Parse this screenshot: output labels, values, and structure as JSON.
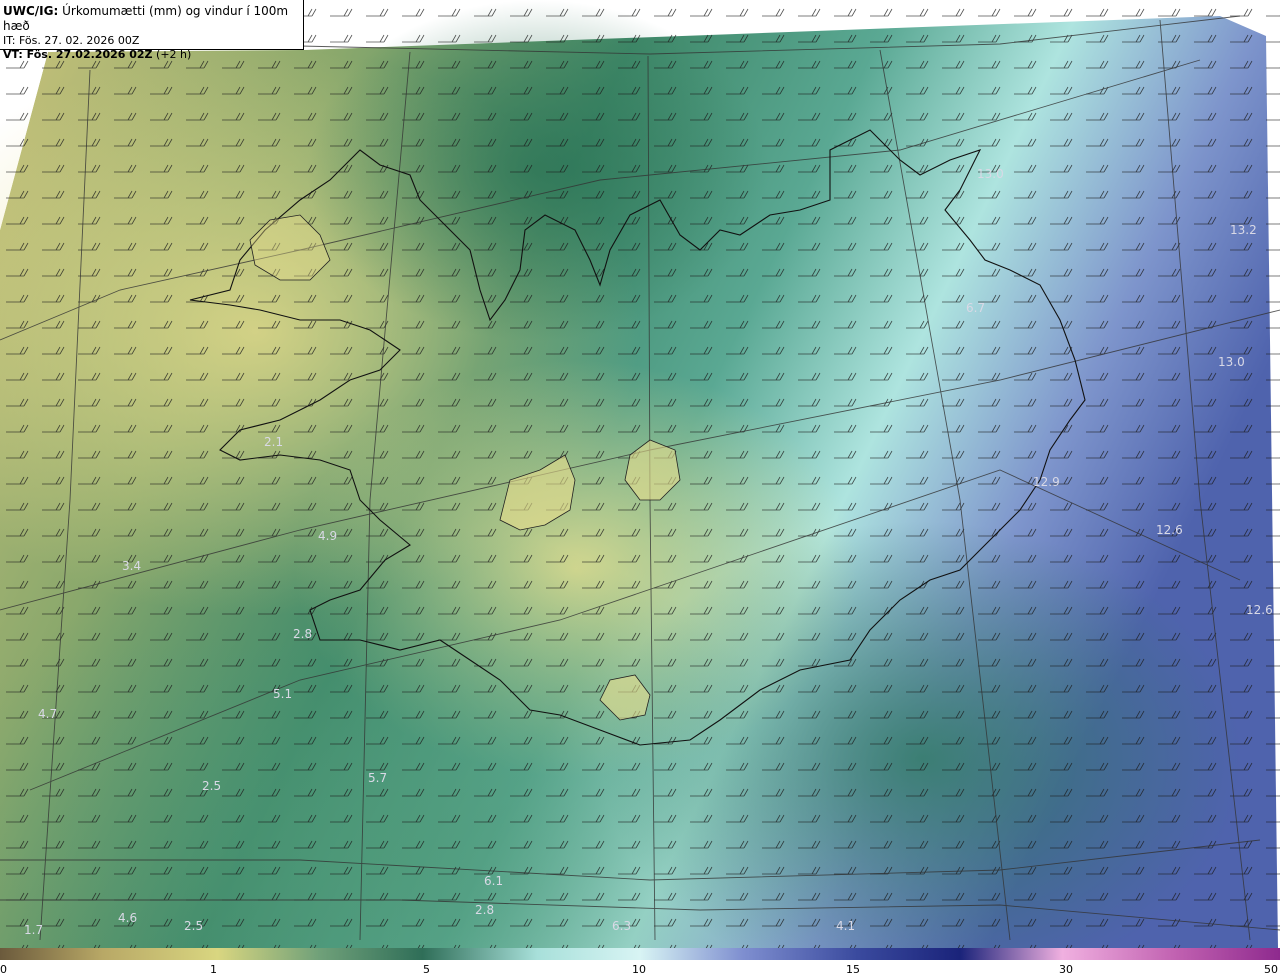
{
  "header": {
    "title_prefix": "UWC/IG:",
    "title_rest": " Úrkomumætti (mm) og vindur í 100m hæð",
    "init_time": "IT: Fös. 27. 02. 2026 00Z",
    "valid_prefix": "VT: Fös. 27.02.2026 02Z",
    "valid_suffix": " (+2 h)"
  },
  "values": [
    {
      "text": "13.0"
    },
    {
      "text": "13.2"
    },
    {
      "text": "6.7"
    },
    {
      "text": "13.0"
    },
    {
      "text": "2.1"
    },
    {
      "text": "12.9"
    },
    {
      "text": "12.6"
    },
    {
      "text": "4.9"
    },
    {
      "text": "3.4"
    },
    {
      "text": "12.6"
    },
    {
      "text": "2.8"
    },
    {
      "text": "5.1"
    },
    {
      "text": "4.7"
    },
    {
      "text": "5.7"
    },
    {
      "text": "2.5"
    },
    {
      "text": "6.1"
    },
    {
      "text": "2.8"
    },
    {
      "text": "4.6"
    },
    {
      "text": "2.5"
    },
    {
      "text": "6.3"
    },
    {
      "text": "4.1"
    },
    {
      "text": "1.7"
    }
  ],
  "colorbar": {
    "ticks": [
      "0",
      "1",
      "5",
      "10",
      "15",
      "30",
      "50"
    ],
    "colors": [
      "#6b5a3c",
      "#b8a866",
      "#d9d680",
      "#6fa079",
      "#2f6e58",
      "#a8e0da",
      "#d8f4f4",
      "#7f8fd0",
      "#3a4a9e",
      "#1a237a",
      "#f0b0e0",
      "#c060b0",
      "#8e2a8e"
    ]
  }
}
